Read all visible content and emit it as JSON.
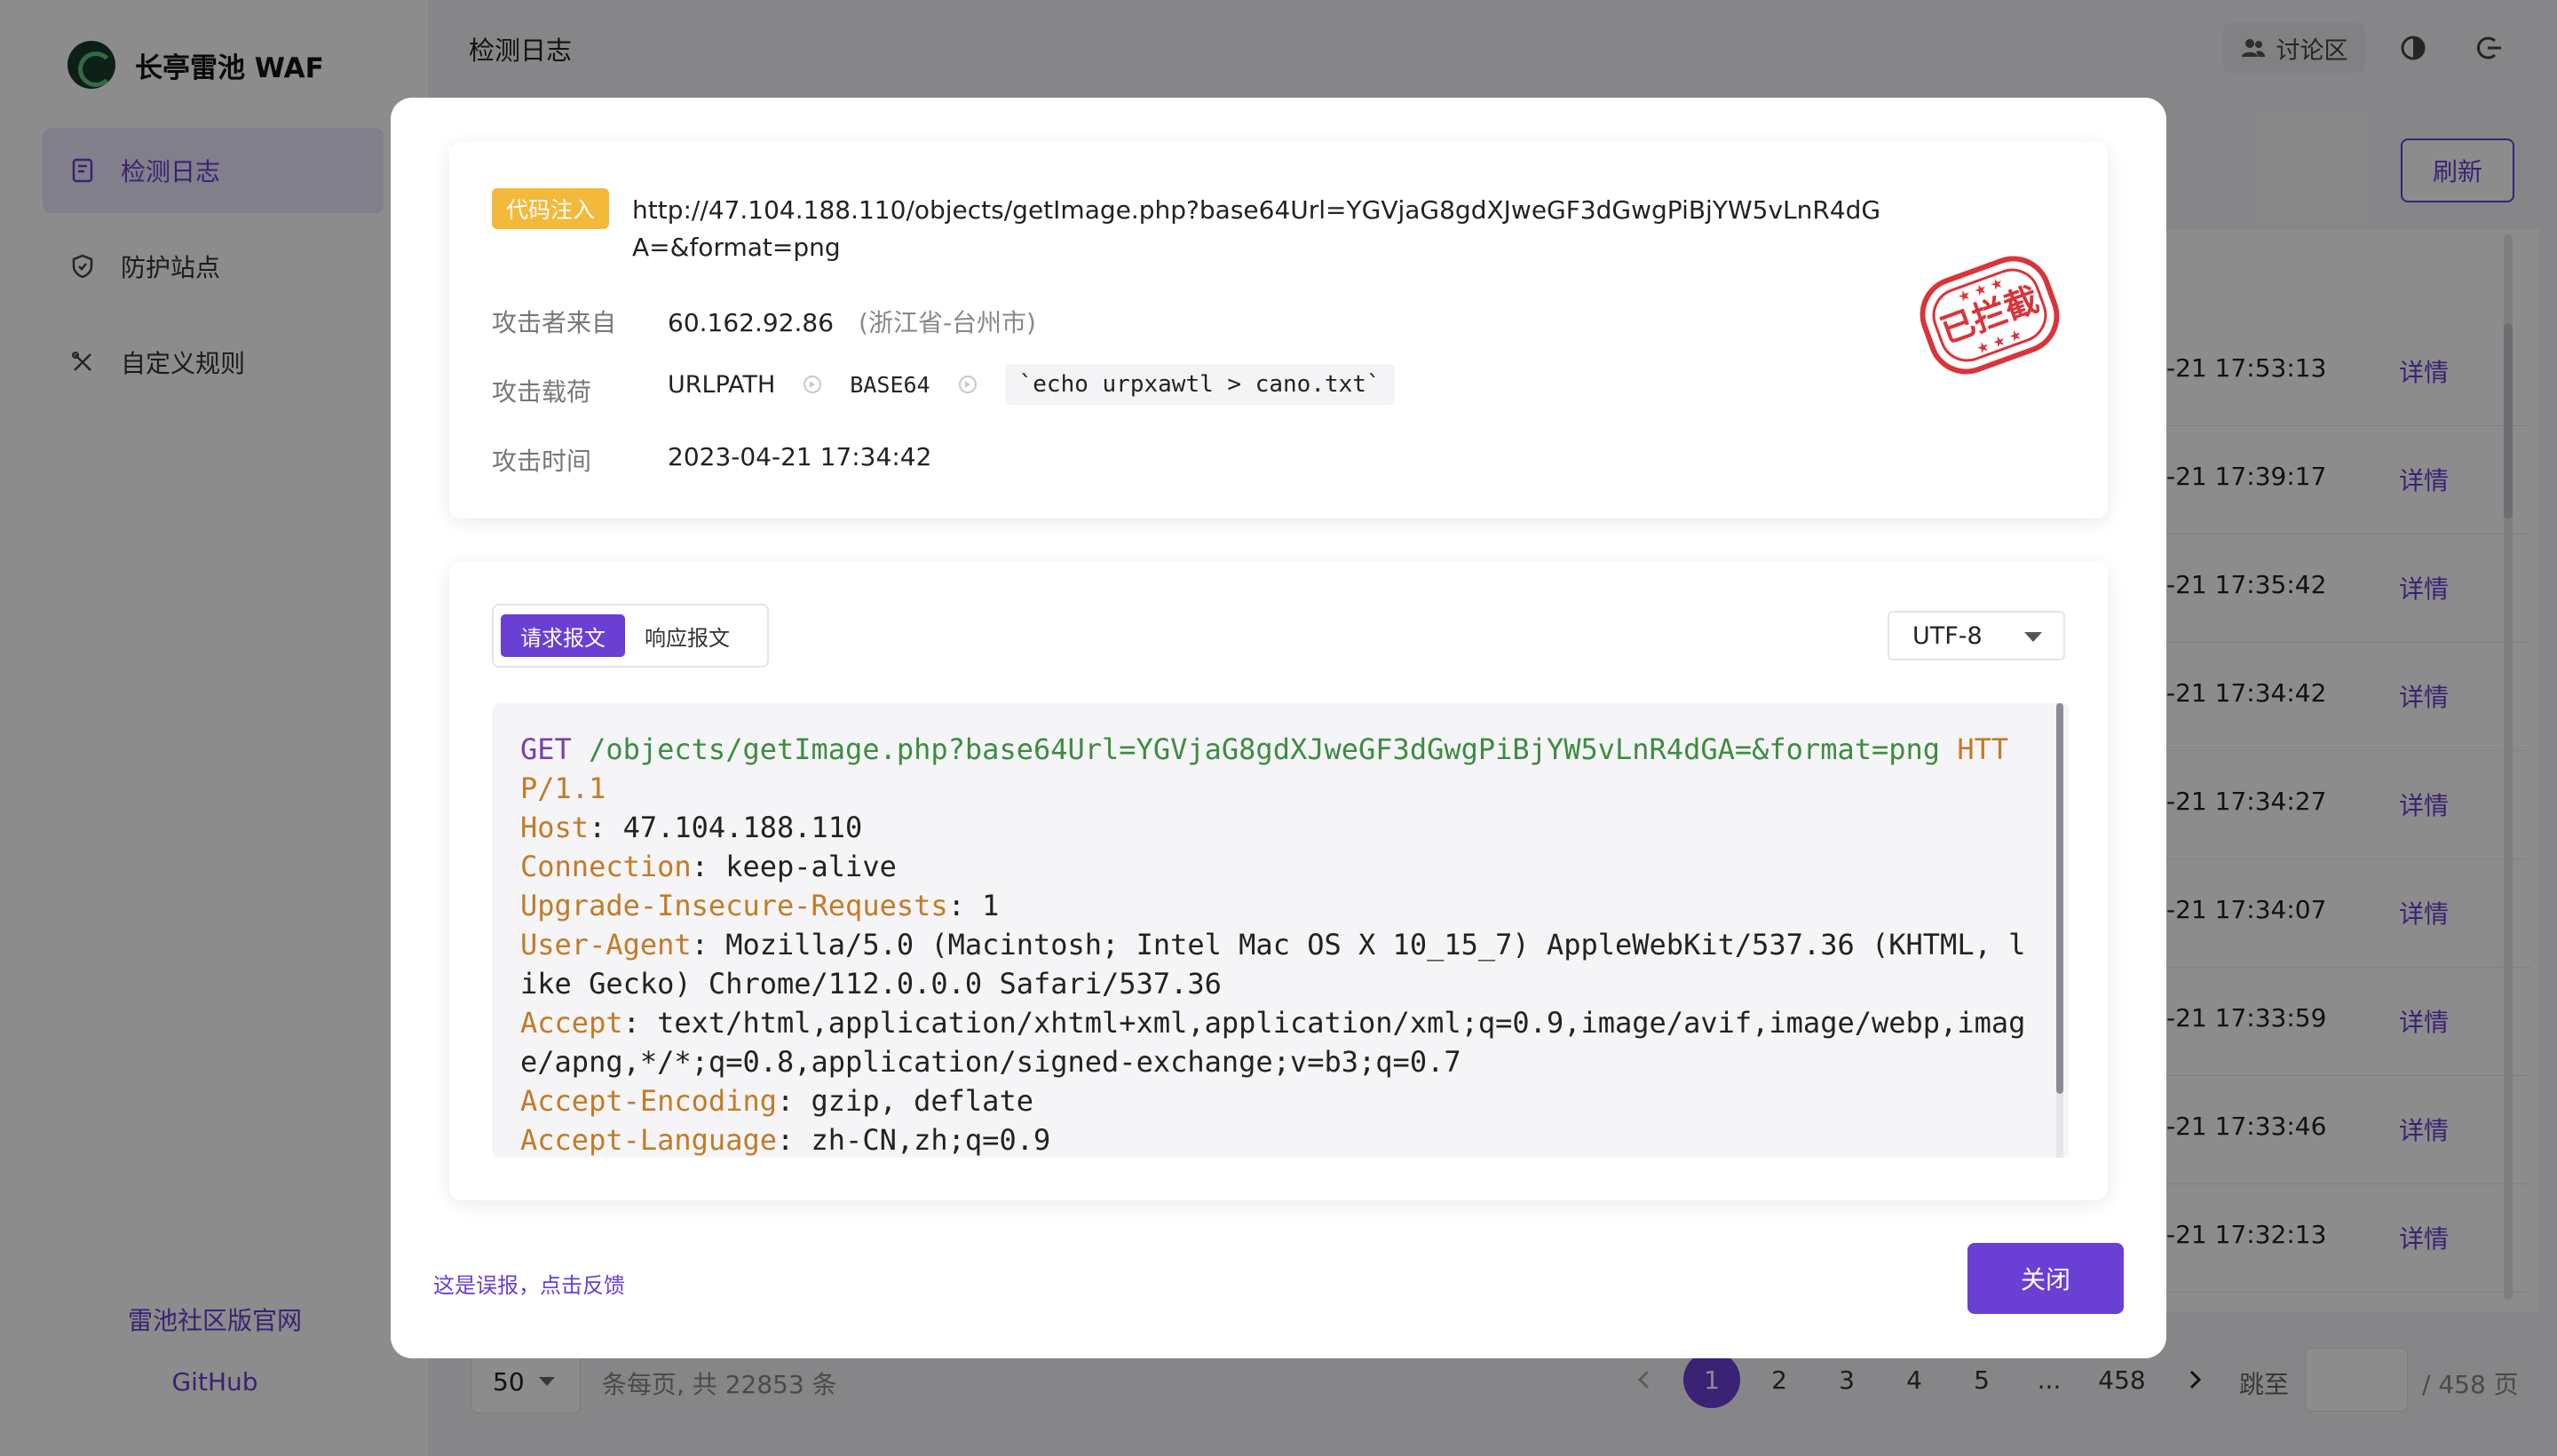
{
  "app": {
    "name": "长亭雷池 WAF"
  },
  "sidebar": {
    "items": [
      {
        "label": "检测日志",
        "icon": "log-icon"
      },
      {
        "label": "防护站点",
        "icon": "shield-icon"
      },
      {
        "label": "自定义规则",
        "icon": "tools-icon"
      }
    ],
    "footer_links": [
      "雷池社区版官网",
      "GitHub"
    ]
  },
  "header": {
    "title": "检测日志",
    "discuss_label": "讨论区",
    "refresh_label": "刷新"
  },
  "table": {
    "rows": [
      {
        "time": "-21 17:53:13",
        "action": "详情"
      },
      {
        "time": "-21 17:39:17",
        "action": "详情"
      },
      {
        "time": "-21 17:35:42",
        "action": "详情"
      },
      {
        "time": "-21 17:34:42",
        "action": "详情"
      },
      {
        "time": "-21 17:34:27",
        "action": "详情"
      },
      {
        "time": "-21 17:34:07",
        "action": "详情"
      },
      {
        "time": "-21 17:33:59",
        "action": "详情"
      },
      {
        "time": "-21 17:33:46",
        "action": "详情"
      },
      {
        "time": "-21 17:32:13",
        "action": "详情"
      }
    ]
  },
  "pagination": {
    "page_size": "50",
    "total_text": "条每页, 共 22853 条",
    "pages": [
      "1",
      "2",
      "3",
      "4",
      "5",
      "...",
      "458"
    ],
    "current_page": "1",
    "jump_label": "跳至",
    "total_pages_text": "/ 458 页"
  },
  "modal": {
    "attack_type": "代码注入",
    "url": "http://47.104.188.110/objects/getImage.php?base64Url=YGVjaG8gdXJweGF3dGwgPiBjYW5vLnR4dGA=&format=png",
    "source_label": "攻击者来自",
    "source_ip": "60.162.92.86",
    "source_location": "(浙江省-台州市)",
    "payload_label": "攻击载荷",
    "payload_location": "URLPATH",
    "payload_encoding": "BASE64",
    "payload_value": "`echo urpxawtl > cano.txt`",
    "time_label": "攻击时间",
    "time_value": "2023-04-21 17:34:42",
    "stamp_text": "已拦截",
    "tabs": [
      "请求报文",
      "响应报文"
    ],
    "encoding": "UTF-8",
    "request": {
      "method": "GET",
      "path": "/objects/getImage.php?base64Url=YGVjaG8gdXJweGF3dGwgPiBjYW5vLnR4dGA=&format=png",
      "protocol": "HTTP/1.1",
      "headers": [
        {
          "key": "Host",
          "value": "47.104.188.110"
        },
        {
          "key": "Connection",
          "value": "keep-alive"
        },
        {
          "key": "Upgrade-Insecure-Requests",
          "value": "1"
        },
        {
          "key": "User-Agent",
          "value": "Mozilla/5.0 (Macintosh; Intel Mac OS X 10_15_7) AppleWebKit/537.36 (KHTML, like Gecko) Chrome/112.0.0.0 Safari/537.36"
        },
        {
          "key": "Accept",
          "value": "text/html,application/xhtml+xml,application/xml;q=0.9,image/avif,image/webp,image/apng,*/*;q=0.8,application/signed-exchange;v=b3;q=0.7"
        },
        {
          "key": "Accept-Encoding",
          "value": "gzip, deflate"
        },
        {
          "key": "Accept-Language",
          "value": "zh-CN,zh;q=0.9"
        }
      ]
    },
    "feedback_label": "这是误报，点击反馈",
    "close_label": "关闭"
  },
  "colors": {
    "accent": "#6a3fd3",
    "tag": "#f3b93a",
    "stamp": "#d9343a"
  }
}
